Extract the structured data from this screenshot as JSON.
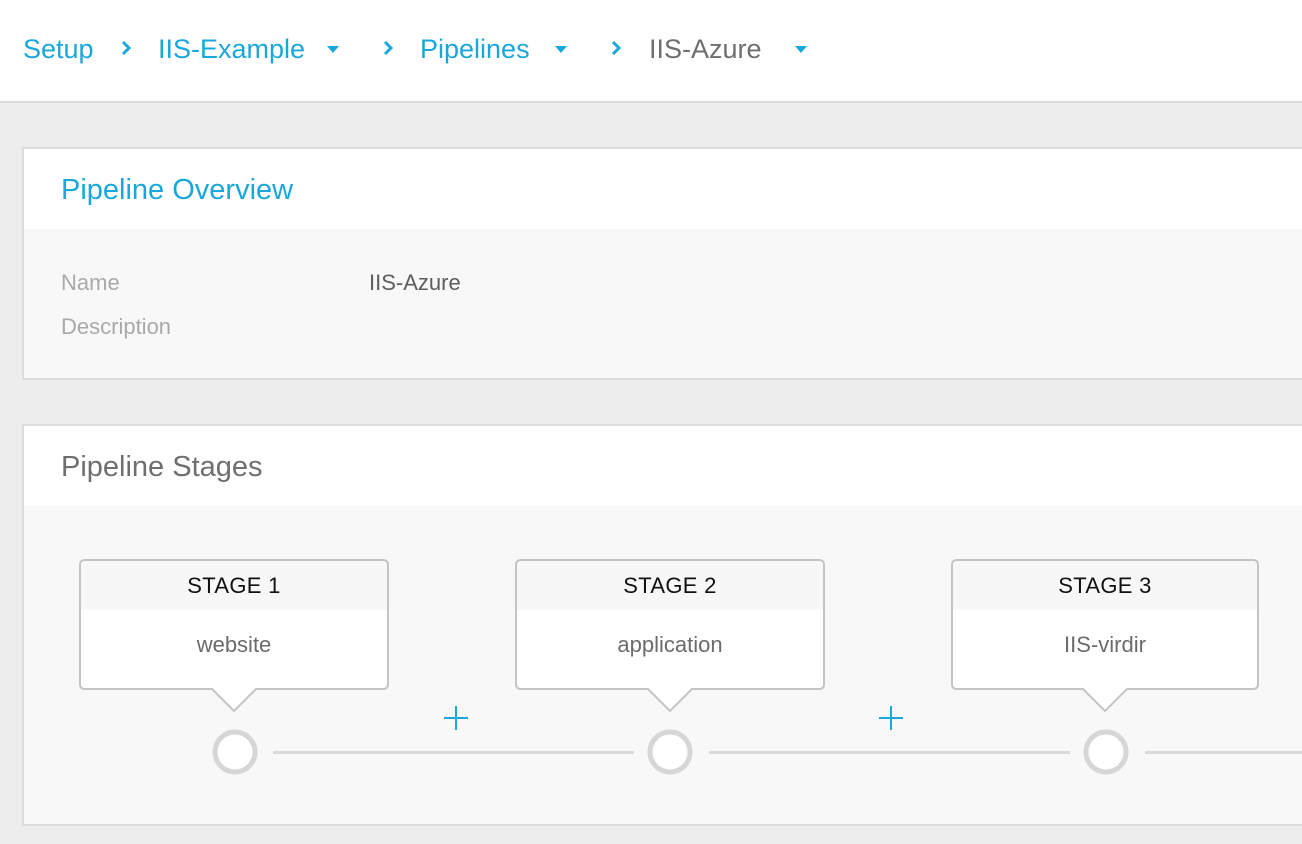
{
  "breadcrumb": {
    "items": [
      {
        "label": "Setup"
      },
      {
        "label": "IIS-Example"
      },
      {
        "label": "Pipelines"
      },
      {
        "label": "IIS-Azure"
      }
    ]
  },
  "overview": {
    "title": "Pipeline Overview",
    "fields": [
      {
        "label": "Name",
        "value": "IIS-Azure"
      },
      {
        "label": "Description",
        "value": ""
      }
    ]
  },
  "stages_panel": {
    "title": "Pipeline Stages",
    "stages": [
      {
        "label": "STAGE 1",
        "name": "website"
      },
      {
        "label": "STAGE 2",
        "name": "application"
      },
      {
        "label": "STAGE 3",
        "name": "IIS-virdir"
      }
    ],
    "add_symbol": "+"
  },
  "colors": {
    "accent": "#1aa7da",
    "text_muted": "#a9a9a9",
    "border": "#dcdcdc",
    "background": "#ededed"
  }
}
